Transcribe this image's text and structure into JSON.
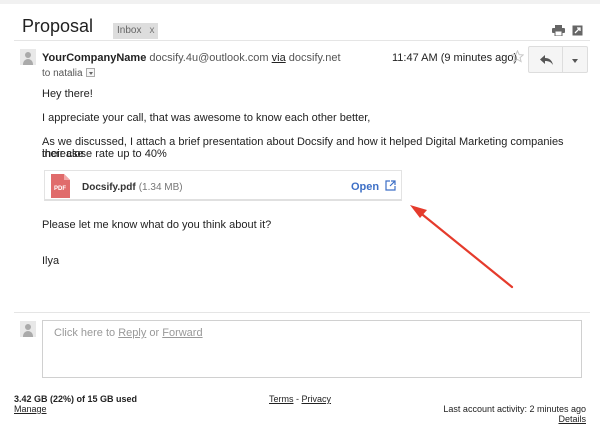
{
  "header": {
    "subject": "Proposal",
    "label_chip": "Inbox",
    "label_remove": "x"
  },
  "message": {
    "sender_name": "YourCompanyName",
    "sender_email": "docsify.4u@outlook.com",
    "via_label": "via",
    "via_domain": "docsify.net",
    "to_line": "to natalia",
    "time": "11:47 AM (9 minutes ago)",
    "body": [
      "Hey there!",
      "I appreciate your call, that was awesome to know each other better,",
      "As we discussed, I attach a brief presentation about Docsify and how it helped Digital Marketing companies increase",
      "their close rate up to 40%",
      "Please let me know what do you think about it?",
      "Ilya"
    ]
  },
  "attachment": {
    "type_label": "PDF",
    "filename": "Docsify.pdf",
    "size": "(1.34 MB)",
    "open_label": "Open"
  },
  "reply_box": {
    "prefix": "Click here to ",
    "reply": "Reply",
    "or": " or ",
    "forward": "Forward"
  },
  "footer": {
    "storage": "3.42 GB (22%) of 15 GB used",
    "manage": "Manage",
    "terms": "Terms",
    "sep": " - ",
    "privacy": "Privacy",
    "last_activity": "Last account activity: 2 minutes ago",
    "details": "Details"
  },
  "colors": {
    "accent_blue": "#3d6fc6",
    "pdf_red": "#e06b6b",
    "annotation_arrow": "#e53b2c"
  },
  "icons": [
    "print-icon",
    "new-window-icon",
    "star-icon",
    "reply-arrow-icon",
    "chevron-down-icon",
    "pdf-icon",
    "external-link-icon",
    "avatar-icon"
  ]
}
